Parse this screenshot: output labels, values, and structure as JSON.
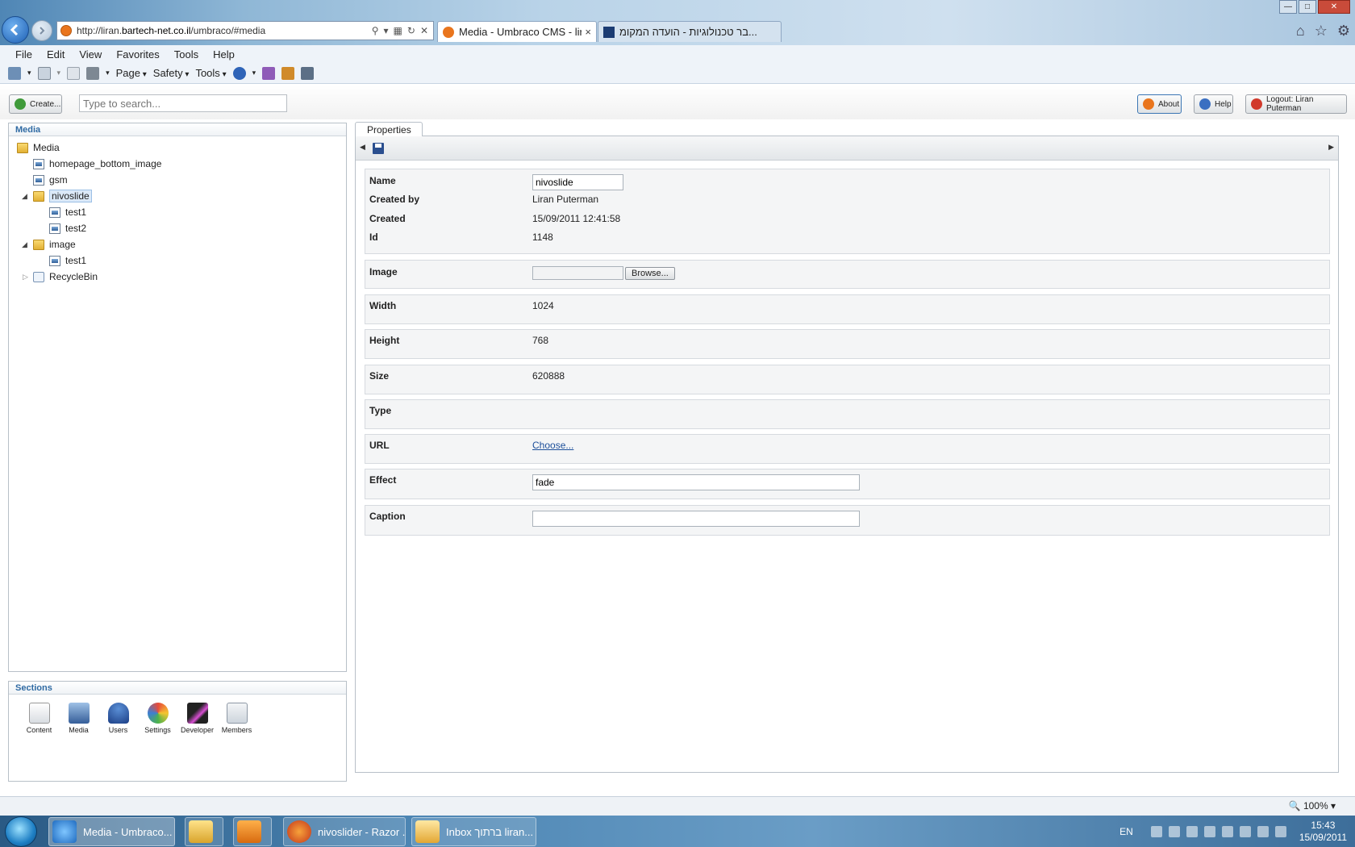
{
  "browser": {
    "url_prefix": "http://liran.",
    "url_domain": "bartech-net.co.il",
    "url_suffix": "/umbraco/#media",
    "tabs": [
      {
        "label": "Media - Umbraco CMS - lir...",
        "close": "×"
      },
      {
        "label": "בר טכנולוגיות - הועדה המקומ..."
      }
    ],
    "menu": [
      "File",
      "Edit",
      "View",
      "Favorites",
      "Tools",
      "Help"
    ],
    "command": {
      "page": "Page",
      "safety": "Safety",
      "tools": "Tools"
    }
  },
  "umbraco": {
    "create_label": "Create...",
    "search_placeholder": "Type to search...",
    "about_label": "About",
    "help_label": "Help",
    "logout_label": "Logout: Liran Puterman"
  },
  "media_panel": {
    "title": "Media",
    "tree": {
      "root": "Media",
      "n1": "homepage_bottom_image",
      "n2": "gsm",
      "n3": "nivoslide",
      "n3a": "test1",
      "n3b": "test2",
      "n4": "image",
      "n4a": "test1",
      "n5": "RecycleBin"
    }
  },
  "sections_panel": {
    "title": "Sections",
    "items": [
      "Content",
      "Media",
      "Users",
      "Settings",
      "Developer",
      "Members"
    ]
  },
  "properties": {
    "tab_label": "Properties",
    "name_label": "Name",
    "name_value": "nivoslide",
    "created_by_label": "Created by",
    "created_by_value": "Liran Puterman",
    "created_label": "Created",
    "created_value": "15/09/2011 12:41:58",
    "id_label": "Id",
    "id_value": "1148",
    "image_label": "Image",
    "browse_label": "Browse...",
    "width_label": "Width",
    "width_value": "1024",
    "height_label": "Height",
    "height_value": "768",
    "size_label": "Size",
    "size_value": "620888",
    "type_label": "Type",
    "url_label": "URL",
    "url_link": "Choose...",
    "effect_label": "Effect",
    "effect_value": "fade",
    "caption_label": "Caption",
    "caption_value": ""
  },
  "status": {
    "zoom": "100%"
  },
  "taskbar": {
    "buttons": [
      "Media - Umbraco...",
      "nivoslider - Razor ...",
      "Inbox ברתוך liran..."
    ],
    "lang": "EN",
    "time": "15:43",
    "date": "15/09/2011"
  },
  "colors": {
    "accent": "#2f6aa3",
    "umbraco_orange": "#e9751d",
    "link": "#1d4f9a"
  }
}
